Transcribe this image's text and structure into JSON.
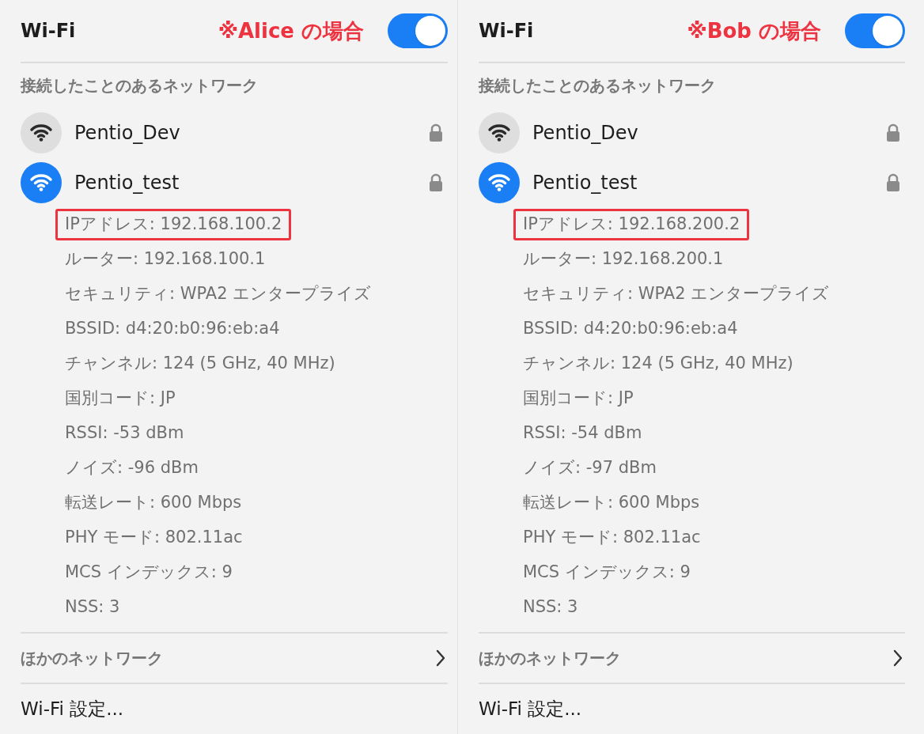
{
  "panels": [
    {
      "title": "Wi-Fi",
      "annotation": "※Alice の場合",
      "toggle_on": true,
      "section_label": "接続したことのあるネットワーク",
      "networks": [
        {
          "name": "Pentio_Dev",
          "connected": false,
          "locked": true
        },
        {
          "name": "Pentio_test",
          "connected": true,
          "locked": true
        }
      ],
      "details": [
        {
          "text": "IPアドレス: 192.168.100.2",
          "highlighted": true
        },
        {
          "text": "ルーター: 192.168.100.1",
          "highlighted": false
        },
        {
          "text": "セキュリティ: WPA2 エンタープライズ",
          "highlighted": false
        },
        {
          "text": "BSSID: d4:20:b0:96:eb:a4",
          "highlighted": false
        },
        {
          "text": "チャンネル: 124 (5 GHz, 40 MHz)",
          "highlighted": false
        },
        {
          "text": "国別コード: JP",
          "highlighted": false
        },
        {
          "text": "RSSI: -53 dBm",
          "highlighted": false
        },
        {
          "text": "ノイズ: -96 dBm",
          "highlighted": false
        },
        {
          "text": "転送レート: 600 Mbps",
          "highlighted": false
        },
        {
          "text": "PHY モード: 802.11ac",
          "highlighted": false
        },
        {
          "text": "MCS インデックス: 9",
          "highlighted": false
        },
        {
          "text": "NSS: 3",
          "highlighted": false
        }
      ],
      "other_networks": "ほかのネットワーク",
      "settings": "Wi-Fi 設定..."
    },
    {
      "title": "Wi-Fi",
      "annotation": "※Bob の場合",
      "toggle_on": true,
      "section_label": "接続したことのあるネットワーク",
      "networks": [
        {
          "name": "Pentio_Dev",
          "connected": false,
          "locked": true
        },
        {
          "name": "Pentio_test",
          "connected": true,
          "locked": true
        }
      ],
      "details": [
        {
          "text": "IPアドレス: 192.168.200.2",
          "highlighted": true
        },
        {
          "text": "ルーター: 192.168.200.1",
          "highlighted": false
        },
        {
          "text": "セキュリティ: WPA2 エンタープライズ",
          "highlighted": false
        },
        {
          "text": "BSSID: d4:20:b0:96:eb:a4",
          "highlighted": false
        },
        {
          "text": "チャンネル: 124 (5 GHz, 40 MHz)",
          "highlighted": false
        },
        {
          "text": "国別コード: JP",
          "highlighted": false
        },
        {
          "text": "RSSI: -54 dBm",
          "highlighted": false
        },
        {
          "text": "ノイズ: -97 dBm",
          "highlighted": false
        },
        {
          "text": "転送レート: 600 Mbps",
          "highlighted": false
        },
        {
          "text": "PHY モード: 802.11ac",
          "highlighted": false
        },
        {
          "text": "MCS インデックス: 9",
          "highlighted": false
        },
        {
          "text": "NSS: 3",
          "highlighted": false
        }
      ],
      "other_networks": "ほかのネットワーク",
      "settings": "Wi-Fi 設定..."
    }
  ]
}
